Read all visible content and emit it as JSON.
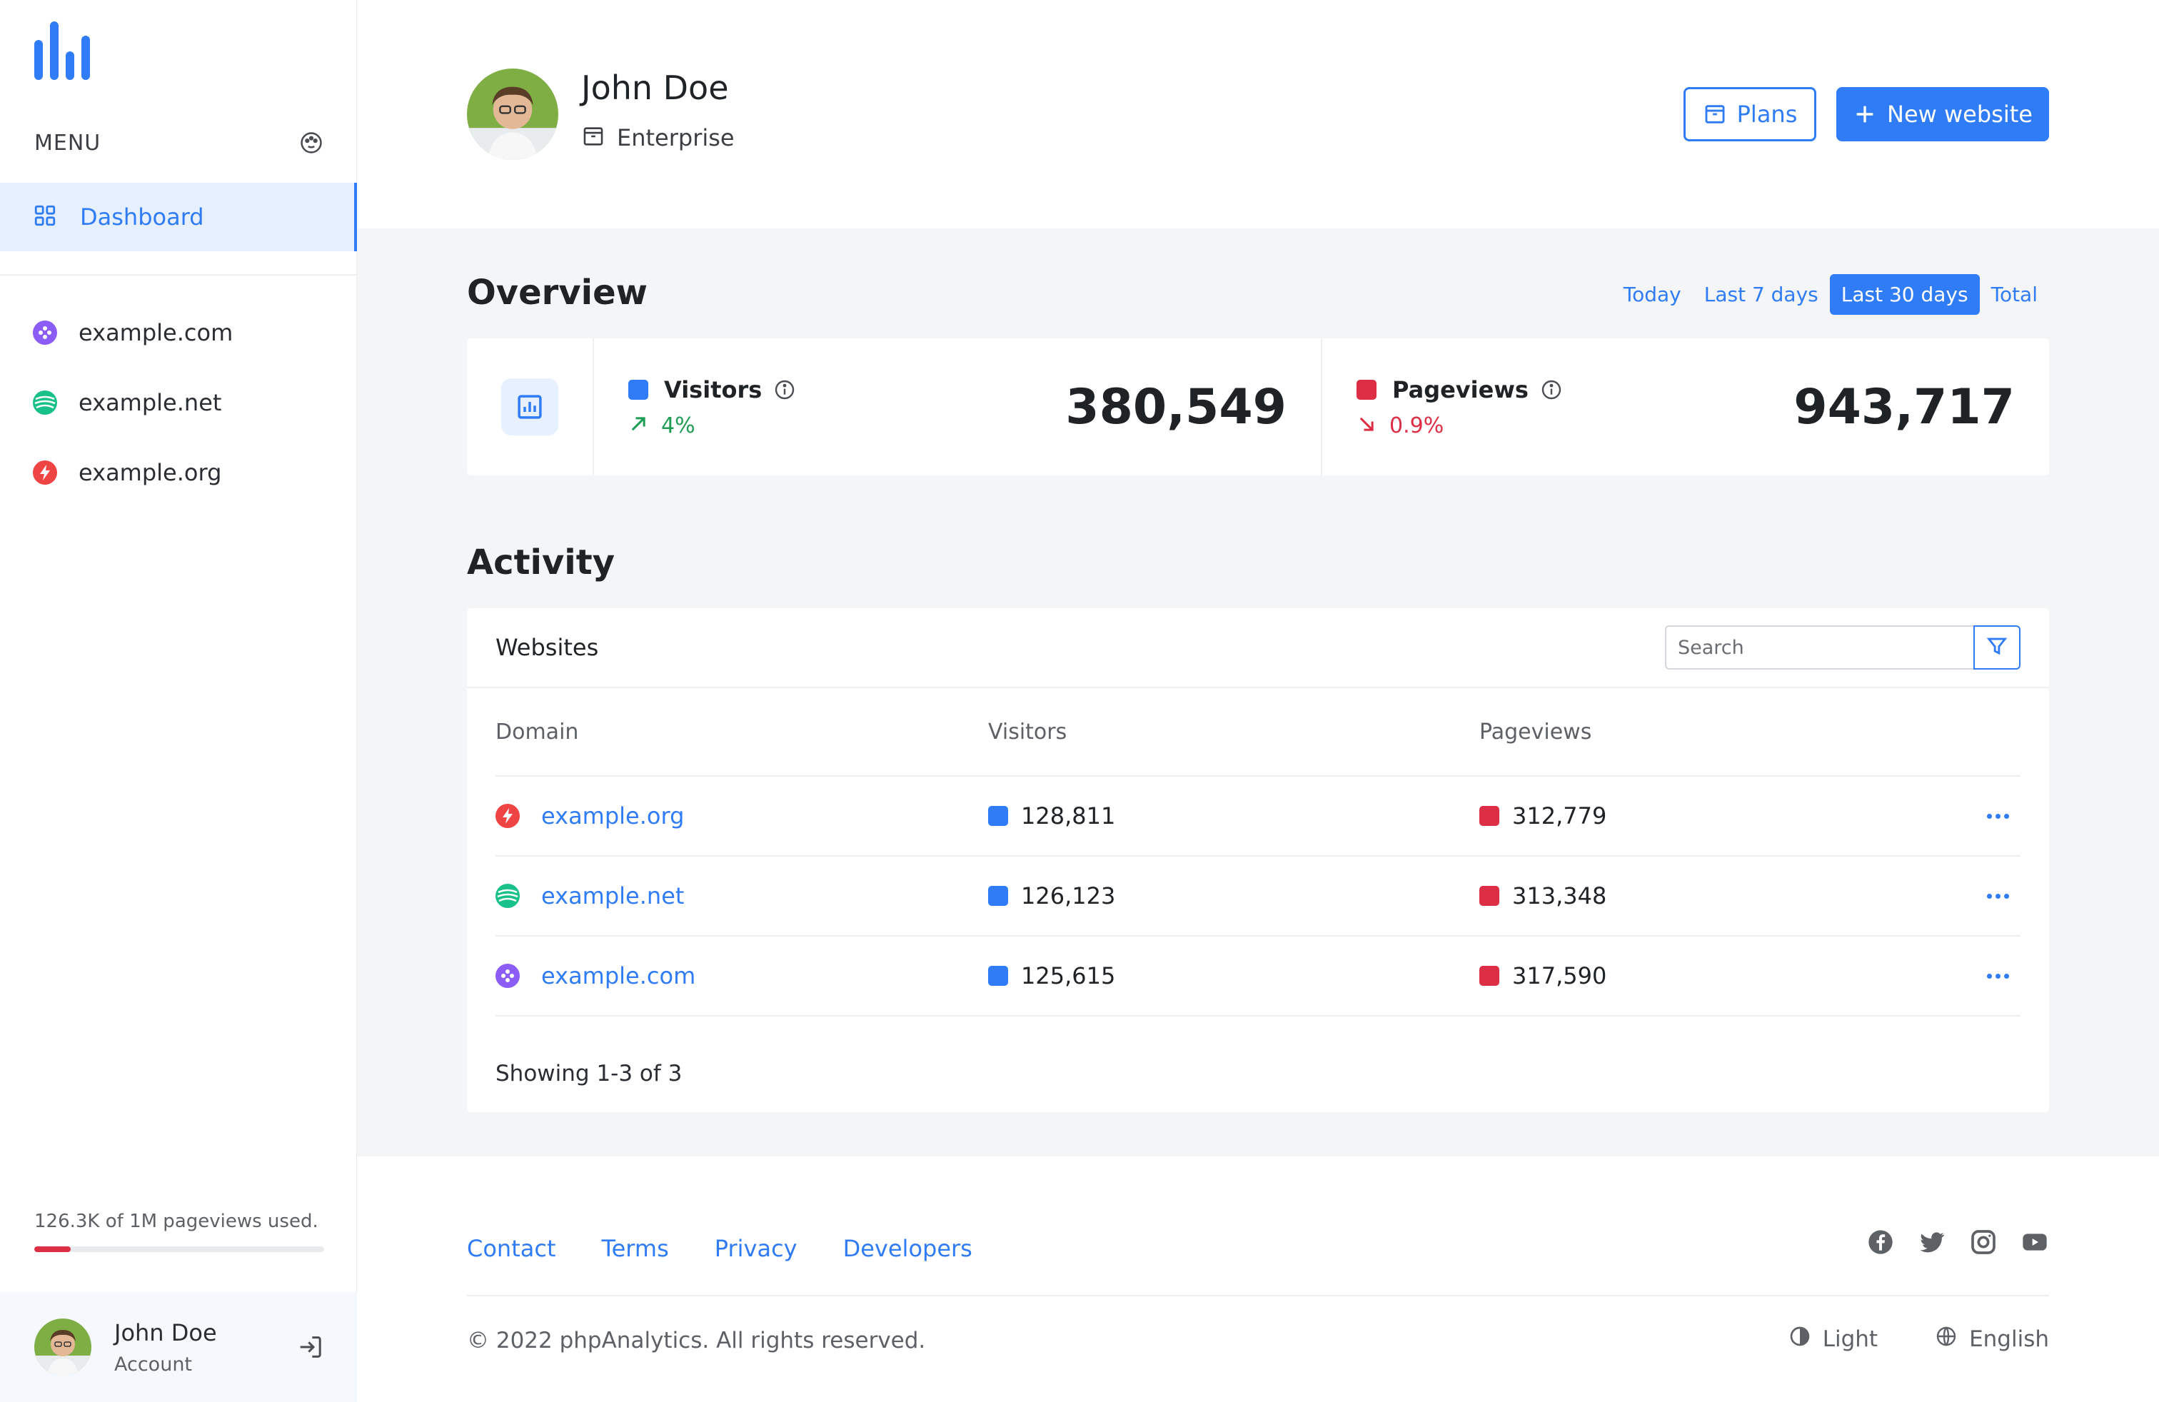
{
  "app": {
    "brand": "phpAnalytics"
  },
  "sidebar": {
    "menu_label": "MENU",
    "nav": [
      {
        "label": "Dashboard",
        "icon": "dashboard-grid-icon",
        "active": true
      }
    ],
    "websites": [
      {
        "label": "example.com",
        "icon": "purple-site-icon",
        "color": "#8b5cf6"
      },
      {
        "label": "example.net",
        "icon": "green-site-icon",
        "color": "#19c18a"
      },
      {
        "label": "example.org",
        "icon": "red-site-icon",
        "color": "#ef4444"
      }
    ],
    "usage": {
      "text": "126.3K of 1M pageviews used.",
      "fraction": 0.126
    },
    "account": {
      "name": "John Doe",
      "sub": "Account"
    }
  },
  "header": {
    "user_name": "John Doe",
    "plan_label": "Enterprise",
    "plans_button": "Plans",
    "new_website_button": "New website"
  },
  "overview": {
    "title": "Overview",
    "ranges": [
      {
        "label": "Today",
        "active": false
      },
      {
        "label": "Last 7 days",
        "active": false
      },
      {
        "label": "Last 30 days",
        "active": true
      },
      {
        "label": "Total",
        "active": false
      }
    ],
    "stats": [
      {
        "name": "Visitors",
        "delta": "4%",
        "trend": "up",
        "value": "380,549",
        "color": "#2f7cf6",
        "delta_color": "#1f9d55"
      },
      {
        "name": "Pageviews",
        "delta": "0.9%",
        "trend": "down",
        "value": "943,717",
        "color": "#dc2f45",
        "delta_color": "#dc2f45"
      }
    ]
  },
  "activity": {
    "title": "Activity",
    "card_title": "Websites",
    "search_placeholder": "Search",
    "columns": {
      "domain": "Domain",
      "visitors": "Visitors",
      "pageviews": "Pageviews"
    },
    "rows": [
      {
        "domain": "example.org",
        "visitors": "128,811",
        "pageviews": "312,779",
        "icon": "red-site-icon"
      },
      {
        "domain": "example.net",
        "visitors": "126,123",
        "pageviews": "313,348",
        "icon": "green-site-icon"
      },
      {
        "domain": "example.com",
        "visitors": "125,615",
        "pageviews": "317,590",
        "icon": "purple-site-icon"
      }
    ],
    "showing": "Showing 1-3 of 3"
  },
  "footer": {
    "links": [
      "Contact",
      "Terms",
      "Privacy",
      "Developers"
    ],
    "socials": [
      "facebook-icon",
      "twitter-icon",
      "instagram-icon",
      "youtube-icon"
    ],
    "copyright": "© 2022 phpAnalytics. All rights reserved.",
    "theme_label": "Light",
    "language_label": "English"
  },
  "colors": {
    "accent": "#2f7cf6",
    "visitors": "#2f7cf6",
    "pageviews": "#dc2f45",
    "background": "#f4f5f6"
  }
}
